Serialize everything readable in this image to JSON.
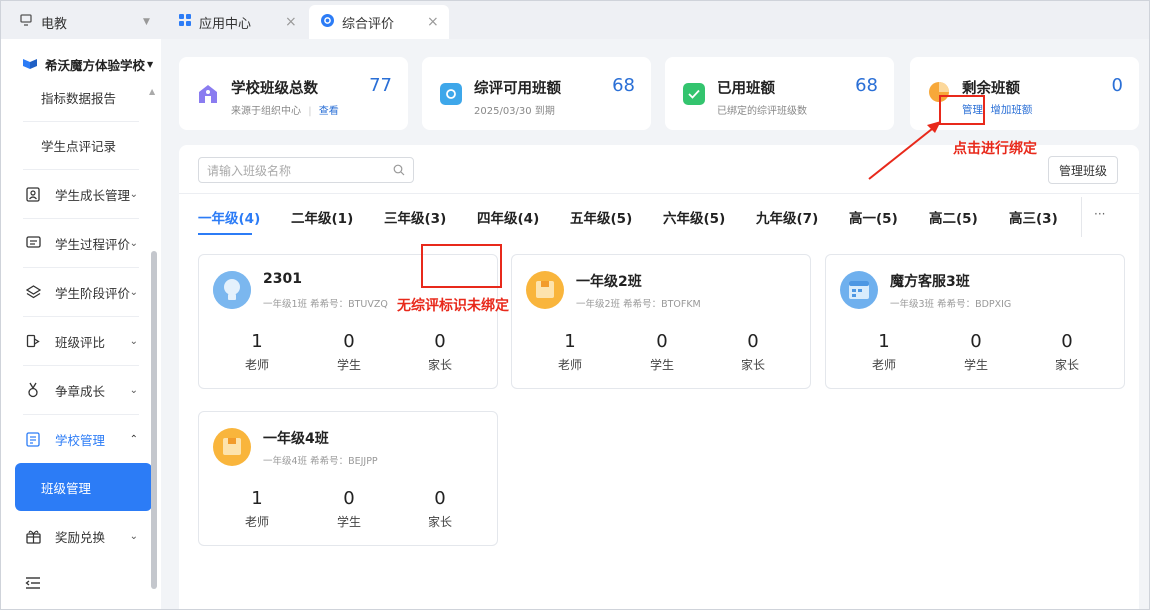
{
  "tabs": [
    {
      "label": "电教",
      "icon": "monitor-icon"
    },
    {
      "label": "应用中心",
      "icon": "grid-icon"
    },
    {
      "label": "综合评价",
      "icon": "app-logo-icon"
    }
  ],
  "sidebar": {
    "school": "希沃魔方体验学校",
    "items": [
      {
        "label": "指标数据报告"
      },
      {
        "label": "学生点评记录"
      },
      {
        "label": "学生成长管理",
        "icon": "id-card-icon"
      },
      {
        "label": "学生过程评价",
        "icon": "message-icon"
      },
      {
        "label": "学生阶段评价",
        "icon": "layers-icon"
      },
      {
        "label": "班级评比",
        "icon": "trophy-icon"
      },
      {
        "label": "争章成长",
        "icon": "medal-icon"
      },
      {
        "label": "学校管理",
        "icon": "school-icon"
      },
      {
        "label": "班级管理"
      },
      {
        "label": "奖励兑换",
        "icon": "gift-icon"
      }
    ]
  },
  "stats": [
    {
      "title": "学校班级总数",
      "sub": "来源于组织中心",
      "sub_link": "查看",
      "value": "77"
    },
    {
      "title": "综评可用班额",
      "sub": "2025/03/30 到期",
      "value": "68"
    },
    {
      "title": "已用班额",
      "sub": "已绑定的综评班级数",
      "value": "68"
    },
    {
      "title": "剩余班额",
      "link1": "管理",
      "link2": "增加班额",
      "value": "0"
    }
  ],
  "search": {
    "placeholder": "请输入班级名称"
  },
  "manage_button": "管理班级",
  "grades": [
    "一年级(4)",
    "二年级(1)",
    "三年级(3)",
    "四年级(4)",
    "五年级(5)",
    "六年级(5)",
    "九年级(7)",
    "高一(5)",
    "高二(5)",
    "高三(3)"
  ],
  "more": "···",
  "stat_labels": {
    "teacher": "老师",
    "student": "学生",
    "parent": "家长"
  },
  "classes": [
    {
      "name": "2301",
      "meta": "一年级1班  希希号：BTUVZQ",
      "teachers": "1",
      "students": "0",
      "parents": "0"
    },
    {
      "name": "一年级2班",
      "meta": "一年级2班  希希号：BTOFKM",
      "teachers": "1",
      "students": "0",
      "parents": "0"
    },
    {
      "name": "魔方客服3班",
      "meta": "一年级3班  希希号：BDPXIG",
      "teachers": "1",
      "students": "0",
      "parents": "0"
    },
    {
      "name": "一年级4班",
      "meta": "一年级4班  希希号：BEJJPP",
      "teachers": "1",
      "students": "0",
      "parents": "0"
    }
  ],
  "annotations": {
    "click_bind": "点击进行绑定",
    "no_mark": "无综评标识未绑定"
  }
}
